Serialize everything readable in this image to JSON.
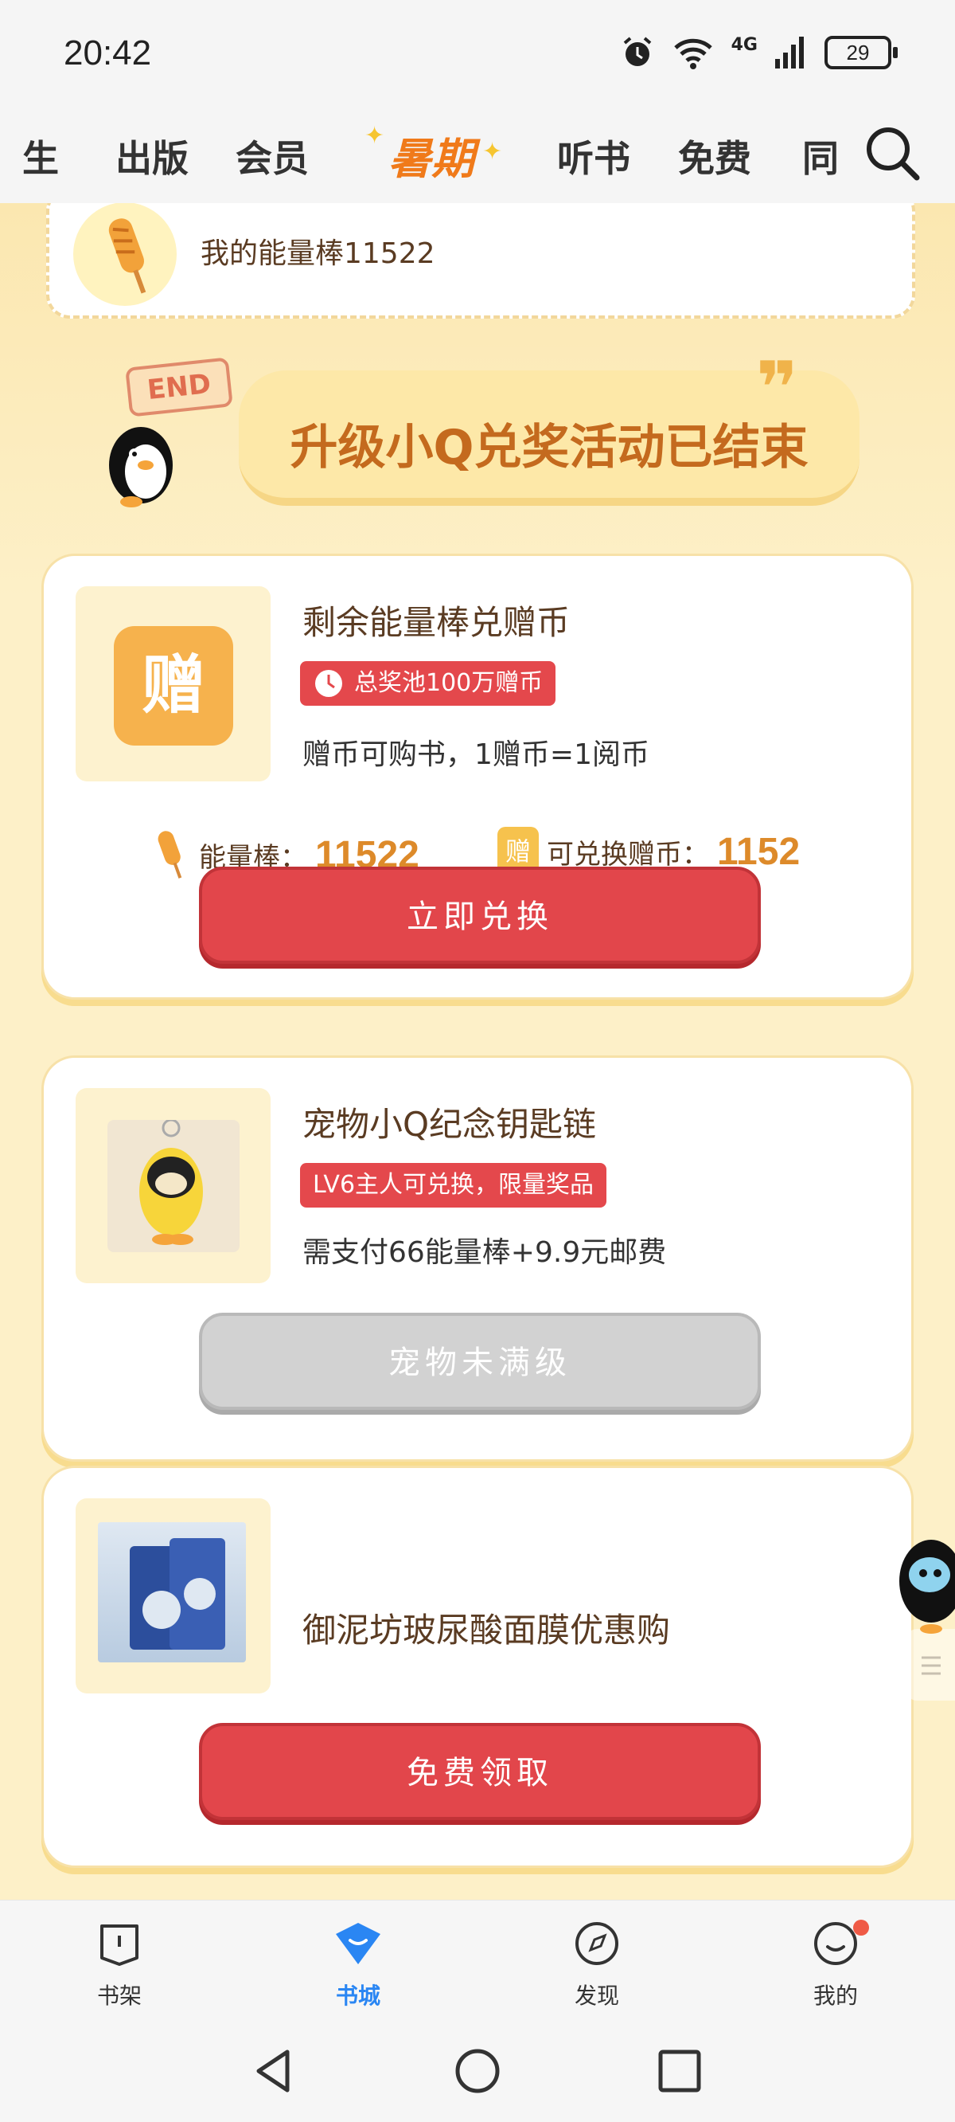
{
  "status": {
    "time": "20:42",
    "network": "4G",
    "battery": "29"
  },
  "tabs": [
    {
      "label": "生"
    },
    {
      "label": "出版"
    },
    {
      "label": "会员"
    },
    {
      "label": "暑期"
    },
    {
      "label": "听书"
    },
    {
      "label": "免费"
    },
    {
      "label": "同"
    }
  ],
  "energy_banner": {
    "text": "我的能量棒11522"
  },
  "end_notice": {
    "sign": "END",
    "title": "升级小Q兑奖活动已结束"
  },
  "cards": [
    {
      "thumb_text": "赠",
      "title": "剩余能量棒兑赠币",
      "tag": "总奖池100万赠币",
      "desc": "赠币可购书，1赠币=1阅币",
      "stat1_label": "能量棒：",
      "stat1_value": "11522",
      "stat2_icon_text": "赠",
      "stat2_label": "可兑换赠币：",
      "stat2_value": "1152",
      "button": "立即兑换"
    },
    {
      "title": "宠物小Q纪念钥匙链",
      "tag": "LV6主人可兑换，限量奖品",
      "desc": "需支付66能量棒+9.9元邮费",
      "button": "宠物未满级"
    },
    {
      "title": "御泥坊玻尿酸面膜优惠购",
      "button": "免费领取"
    }
  ],
  "bottom_nav": [
    {
      "label": "书架"
    },
    {
      "label": "书城"
    },
    {
      "label": "发现"
    },
    {
      "label": "我的"
    }
  ],
  "colors": {
    "accent_blue": "#2a86f3",
    "button_red": "#e2464b",
    "orange": "#f07a1a"
  }
}
